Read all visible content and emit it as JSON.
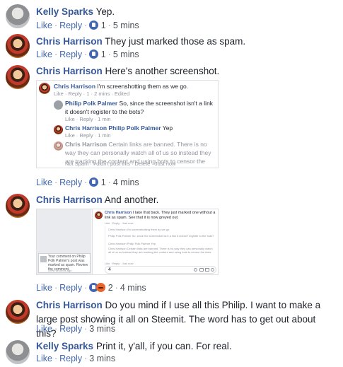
{
  "colors": {
    "name": "#365899",
    "link": "#4267b2",
    "meta": "#4b4f56",
    "border": "#dddfe2"
  },
  "actions": {
    "like": "Like",
    "reply": "Reply",
    "sep": "·"
  },
  "comments": [
    {
      "author": "Kelly Sparks",
      "text": "Yep.",
      "reactions": "1",
      "time": "5 mins"
    },
    {
      "author": "Chris Harrison",
      "text": "They just marked those as spam.",
      "reactions": "1",
      "time": "5 mins"
    },
    {
      "author": "Chris Harrison",
      "text": "Here's another screenshot.",
      "reactions": "1",
      "time": "4 mins"
    },
    {
      "author": "Chris Harrison",
      "text": "And another.",
      "reactions": "2",
      "time": "4 mins"
    },
    {
      "author": "Chris Harrison",
      "text": "Do you mind if I use all this Philip. I want to make a large post showing it all on Steemit. The word has to get out about this?",
      "time": "3 mins"
    },
    {
      "author": "Kelly Sparks",
      "text": "Print it, y'all, if you can. For real.",
      "time": "3 mins"
    }
  ],
  "shot1": {
    "c1_author": "Chris Harrison",
    "c1_text": "I'm screenshotting them as we go.",
    "c1_meta": "Like · Reply · 1 · 2 mins · Edited",
    "c2_author": "Philip Polk Palmer",
    "c2_text": "So, since the screenshot isn't a link it doesn't register to the bots?",
    "c2_meta": "Like · Reply · 1 min",
    "c3_author": "Chris Harrison",
    "c3_mention": "Philip Polk Palmer",
    "c3_text": "Yep",
    "c3_meta": "Like · Reply · 1 min",
    "c4_author": "Chris Harrison",
    "c4_text": "Certain links are banned. There is no way they can personally watch all of us so instead they are tracking the content and using bots to censor the links.",
    "c4_meta": "Not Spam · I didn't post this · Delete · Just now"
  },
  "shot2": {
    "notice_text": "Your comment on Philip Polk Palmer's post was marked as spam. Review the comment.",
    "notice_time": "a few seconds ago",
    "c1_author": "Chris Harrison",
    "c1_text": "I take that back. They just marked one without a link as spam. See that it is now greyed out.",
    "c1_meta": "Like · Reply · Just now",
    "inner1": "Chris Harrison I'm screenshotting them as we go.",
    "inner2": "Philip Polk Palmer So, since the screenshot isn't a link it doesn't register to the bots?",
    "inner3": "Chris Harrison Philip Polk Palmer Yep",
    "inner4": "Chris Harrison Certain links are banned. There is no way they can personally watch all of us so instead they are tracking the content and using bots to censor the links.",
    "input_value": "4"
  }
}
